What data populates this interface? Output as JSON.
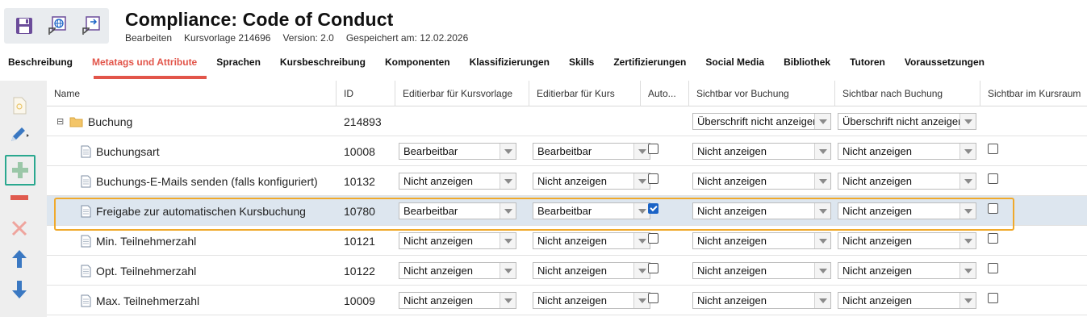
{
  "header": {
    "title": "Compliance: Code of Conduct",
    "subtitle": {
      "mode": "Bearbeiten",
      "template": "Kursvorlage 214696",
      "version": "Version: 2.0",
      "saved": "Gespeichert am: 12.02.2026"
    },
    "icons": [
      "save-icon",
      "publish-web-icon",
      "export-icon"
    ]
  },
  "tabs": [
    {
      "label": "Beschreibung",
      "active": false
    },
    {
      "label": "Metatags und Attribute",
      "active": true
    },
    {
      "label": "Sprachen",
      "active": false
    },
    {
      "label": "Kursbeschreibung",
      "active": false
    },
    {
      "label": "Komponenten",
      "active": false
    },
    {
      "label": "Klassifizierungen",
      "active": false
    },
    {
      "label": "Skills",
      "active": false
    },
    {
      "label": "Zertifizierungen",
      "active": false
    },
    {
      "label": "Social Media",
      "active": false
    },
    {
      "label": "Bibliothek",
      "active": false
    },
    {
      "label": "Tutoren",
      "active": false
    },
    {
      "label": "Voraussetzungen",
      "active": false
    }
  ],
  "toolbar": [
    "new-document-icon",
    "edit-pencil-icon",
    "add-plus-icon",
    "remove-minus-icon",
    "delete-x-icon",
    "move-up-icon",
    "move-down-icon"
  ],
  "colors": {
    "accent": "#e2554a",
    "highlight_outline": "#f0a92b",
    "add_button_outline": "#2aa88f",
    "selected_row": "#dde6ef",
    "checkbox_checked": "#1a63c6"
  },
  "table": {
    "columns": [
      "Name",
      "ID",
      "Editierbar für Kursvorlage",
      "Editierbar für Kurs",
      "Auto...",
      "Sichtbar vor Buchung",
      "Sichtbar nach Buchung",
      "Sichtbar im Kursraum"
    ],
    "rows": [
      {
        "name": "Buchung",
        "id": "214893",
        "type": "folder",
        "edit_template": null,
        "edit_course": null,
        "auto": null,
        "before": "Überschrift nicht anzeigen",
        "after": "Überschrift nicht anzeigen",
        "room": null
      },
      {
        "name": "Buchungsart",
        "id": "10008",
        "type": "doc",
        "edit_template": "Bearbeitbar",
        "edit_course": "Bearbeitbar",
        "auto": false,
        "before": "Nicht anzeigen",
        "after": "Nicht anzeigen",
        "room": false
      },
      {
        "name": "Buchungs-E-Mails senden (falls konfiguriert)",
        "id": "10132",
        "type": "doc",
        "edit_template": "Nicht anzeigen",
        "edit_course": "Nicht anzeigen",
        "auto": false,
        "before": "Nicht anzeigen",
        "after": "Nicht anzeigen",
        "room": false
      },
      {
        "name": "Freigabe zur automatischen Kursbuchung",
        "id": "10780",
        "type": "doc",
        "edit_template": "Bearbeitbar",
        "edit_course": "Bearbeitbar",
        "auto": true,
        "before": "Nicht anzeigen",
        "after": "Nicht anzeigen",
        "room": false,
        "selected": true
      },
      {
        "name": "Min. Teilnehmerzahl",
        "id": "10121",
        "type": "doc",
        "edit_template": "Nicht anzeigen",
        "edit_course": "Nicht anzeigen",
        "auto": false,
        "before": "Nicht anzeigen",
        "after": "Nicht anzeigen",
        "room": false
      },
      {
        "name": "Opt. Teilnehmerzahl",
        "id": "10122",
        "type": "doc",
        "edit_template": "Nicht anzeigen",
        "edit_course": "Nicht anzeigen",
        "auto": false,
        "before": "Nicht anzeigen",
        "after": "Nicht anzeigen",
        "room": false
      },
      {
        "name": "Max. Teilnehmerzahl",
        "id": "10009",
        "type": "doc",
        "edit_template": "Nicht anzeigen",
        "edit_course": "Nicht anzeigen",
        "auto": false,
        "before": "Nicht anzeigen",
        "after": "Nicht anzeigen",
        "room": false
      }
    ]
  }
}
